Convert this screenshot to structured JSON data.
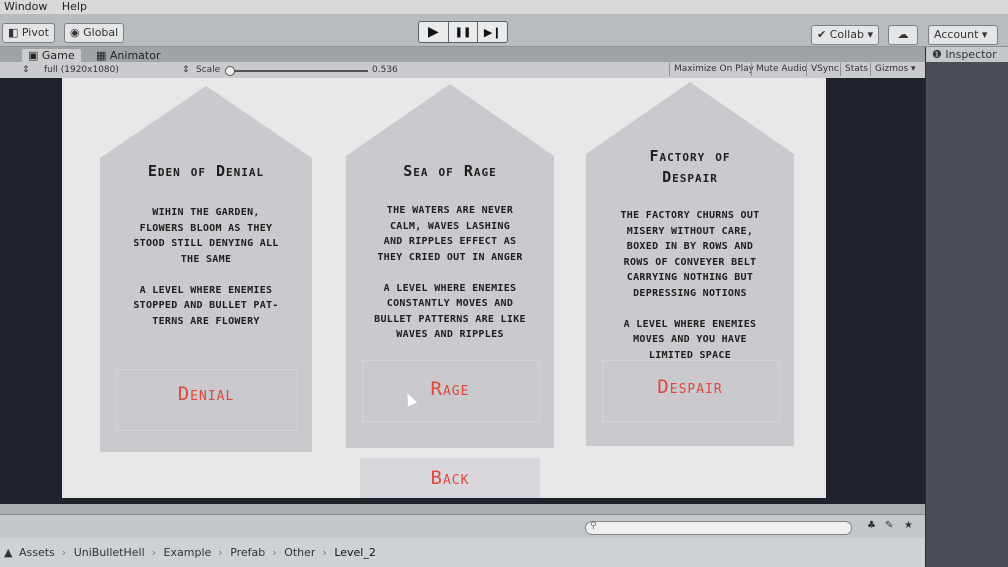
{
  "menu": [
    "Window",
    "Help"
  ],
  "toolbar": {
    "pivot": "Pivot",
    "global": "Global",
    "play_icon": "▶",
    "pause_icon": "❚❚",
    "step_icon": "▶❙",
    "collab": "Collab ▾",
    "cloud_icon": "☁",
    "account": "Account ▾"
  },
  "tabs": {
    "game": "Game",
    "animator": "Animator",
    "inspector": "Inspector"
  },
  "gamebar": {
    "display": "full (1920x1080)",
    "scale_label": "Scale",
    "scale_value": "0.536",
    "maximize": "Maximize On Play",
    "mute": "Mute Audio",
    "vsync": "VSync",
    "stats": "Stats",
    "gizmos": "Gizmos ▾"
  },
  "cards": [
    {
      "title": "Eden of Denial",
      "description": "Wihin the garden,\nflowers bloom as they\nstood still denying all\nthe same\n\na level where enemies\nstopped and bullet pat-\nterns are flowery",
      "button": "Denial"
    },
    {
      "title": "Sea of Rage",
      "description": "The waters are never\ncalm, waves lashing\nand ripples effect as\nthey cried out in anger\n\na level where enemies\nconstantly moves and\nbullet patterns are like\nwaves and ripples",
      "button": "Rage"
    },
    {
      "title": "Factory of\nDespair",
      "description": "The factory churns out\nmisery without care,\nboxed in by rows and\nrows of conveyer belt\ncarrying nothing but\ndepressing notions\n\na level where enemies\nmoves and you have\nlimited space",
      "button": "Despair"
    }
  ],
  "back_button": "Back",
  "project": {
    "search_placeholder": "",
    "breadcrumb": [
      "Assets",
      "UniBulletHell",
      "Example",
      "Prefab",
      "Other",
      "Level_2"
    ]
  },
  "colors": {
    "accent": "#e2473c",
    "card_fill": "#c9c9ce",
    "canvas_bg": "#e8e8e9"
  }
}
